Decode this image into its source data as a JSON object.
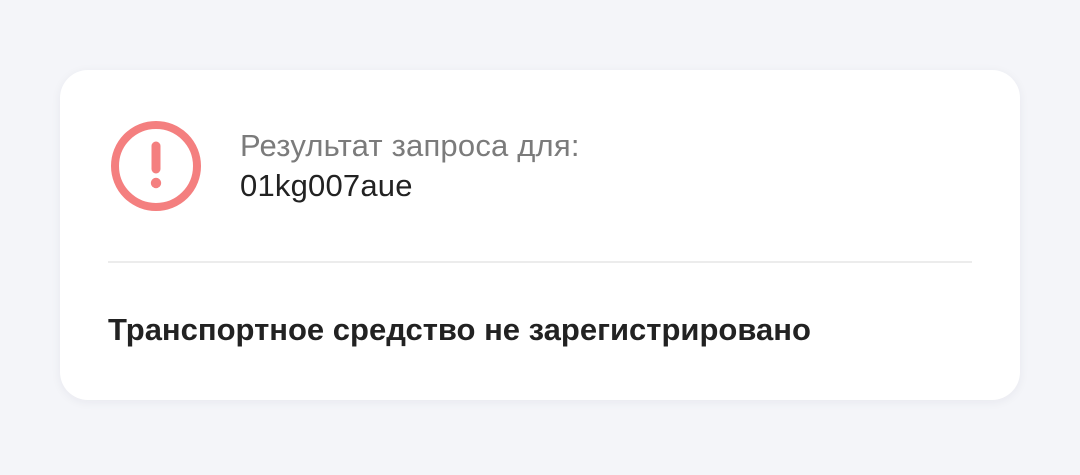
{
  "icon": "exclamation-circle-icon",
  "colors": {
    "alert": "#f47f7f",
    "background": "#f4f5f9",
    "card": "#ffffff"
  },
  "query": {
    "label": "Результат запроса для:",
    "value": "01kg007aue"
  },
  "result": {
    "message": "Транспортное средство не зарегистрировано"
  }
}
